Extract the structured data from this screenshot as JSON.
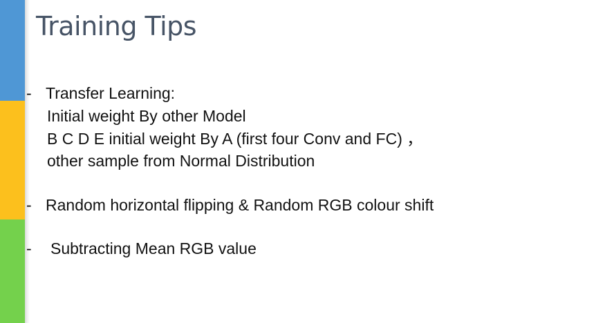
{
  "slide": {
    "title": "Training Tips",
    "bullet_marker": "-",
    "bullets": [
      {
        "heading": "Transfer Learning:",
        "lines": [
          "Initial weight By other Model",
          "B C D E initial weight By A (first four Conv and FC) ，",
          "other sample from Normal Distribution"
        ]
      },
      {
        "heading": "Random horizontal flipping & Random RGB colour shift"
      },
      {
        "heading": "Subtracting Mean RGB value"
      }
    ]
  },
  "colors": {
    "sidebar_blue": "#4f97d5",
    "sidebar_yellow": "#fcc01d",
    "sidebar_green": "#74d14c",
    "title_color": "#475466",
    "text_color": "#111111"
  }
}
